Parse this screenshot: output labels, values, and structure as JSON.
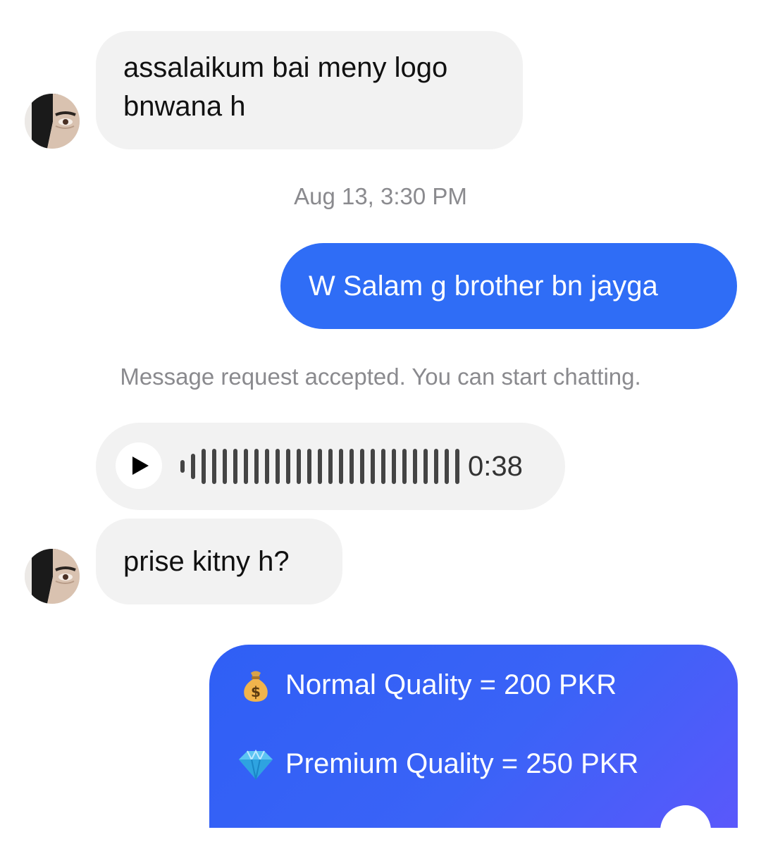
{
  "messages": {
    "m1": {
      "text": "assalaikum bai meny logo bnwana h"
    },
    "timestamp": "Aug 13, 3:30 PM",
    "m2": {
      "text": "W Salam g brother bn jayga"
    },
    "system_note": "Message request accepted. You can start chatting.",
    "voice": {
      "duration": "0:38"
    },
    "m3": {
      "text": "prise kitny h?"
    },
    "pricing": {
      "normal": "Normal Quality = 200 PKR",
      "premium": "Premium Quality = 250 PKR"
    }
  },
  "icons": {
    "play": "play-icon",
    "money_bag": "money-bag-icon",
    "gem": "gem-icon"
  },
  "colors": {
    "outgoing": "#2f6df6",
    "incoming": "#f2f2f2",
    "meta_text": "#8a8a8e",
    "card_gradient_end": "#5a58fb"
  }
}
